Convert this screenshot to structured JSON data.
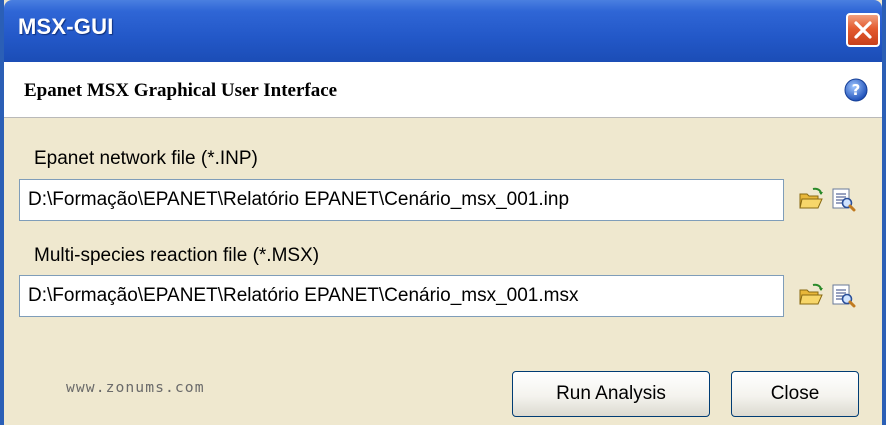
{
  "window": {
    "title": "MSX-GUI",
    "header": "Epanet MSX Graphical User Interface"
  },
  "form": {
    "inp_label": "Epanet network file (*.INP)",
    "inp_value": "D:\\Formação\\EPANET\\Relatório EPANET\\Cenário_msx_001.inp",
    "msx_label": "Multi-species reaction file (*.MSX)",
    "msx_value": "D:\\Formação\\EPANET\\Relatório EPANET\\Cenário_msx_001.msx"
  },
  "footer": {
    "watermark": "www.zonums.com",
    "run_label": "Run Analysis",
    "close_label": "Close"
  },
  "icons": {
    "close": "close-icon",
    "help": "help-icon",
    "open_folder": "open-folder-icon",
    "view_file": "view-file-icon"
  },
  "colors": {
    "titlebar": "#2358c8",
    "body": "#efe8cf",
    "close_button": "#e45b2f"
  }
}
